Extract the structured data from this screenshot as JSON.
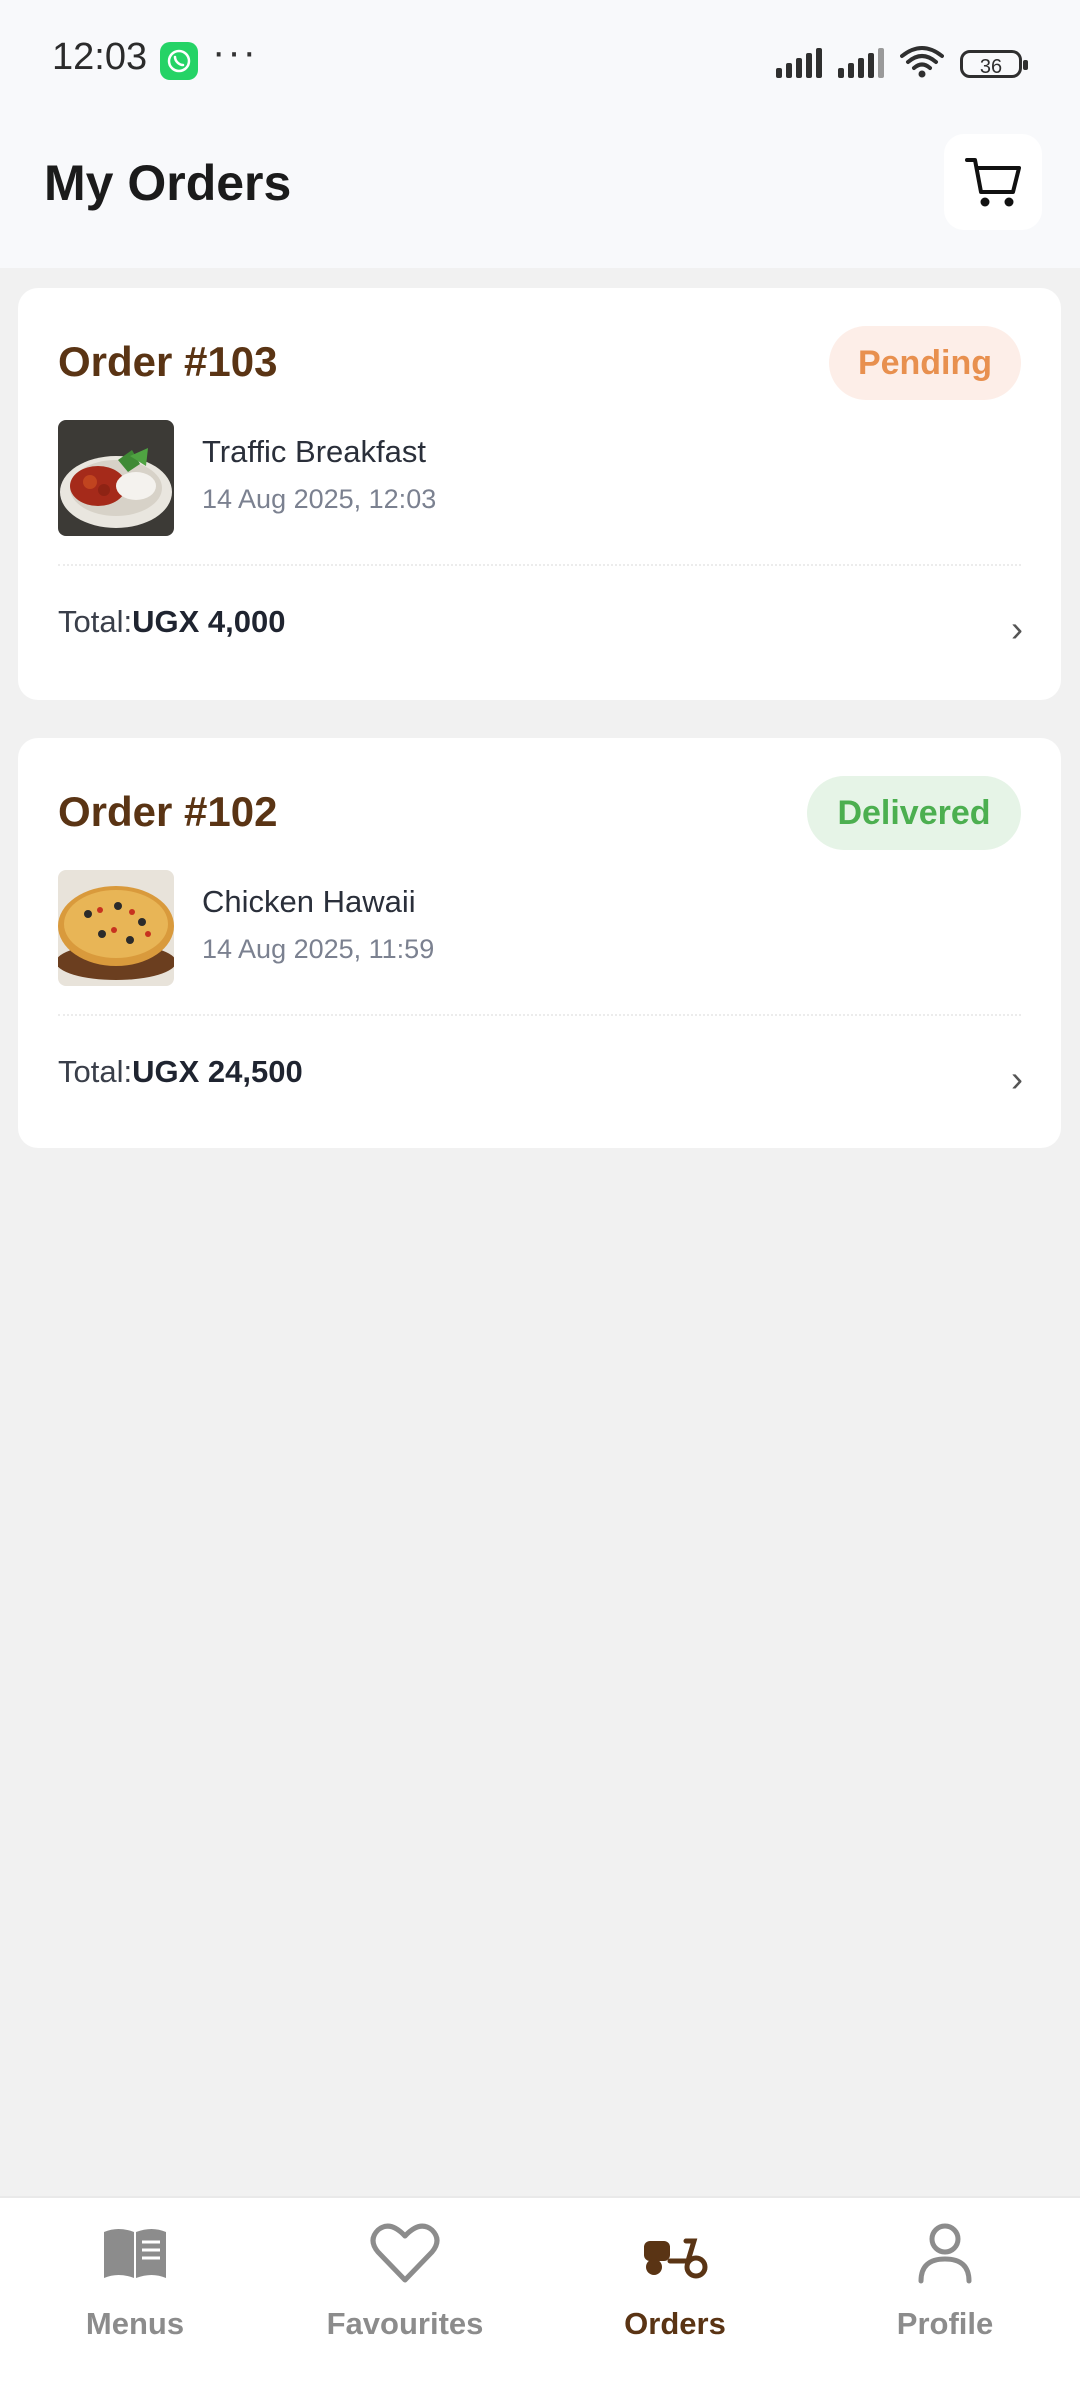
{
  "status_bar": {
    "time": "12:03",
    "battery": "36"
  },
  "header": {
    "title": "My Orders"
  },
  "orders": [
    {
      "title": "Order #103",
      "status": "Pending",
      "item_name": "Traffic Breakfast",
      "item_date": "14 Aug 2025, 12:03",
      "total_label": "Total:",
      "total_value": "UGX 4,000"
    },
    {
      "title": "Order #102",
      "status": "Delivered",
      "item_name": "Chicken Hawaii",
      "item_date": "14 Aug 2025, 11:59",
      "total_label": "Total:",
      "total_value": "UGX 24,500"
    }
  ],
  "nav": {
    "items": [
      {
        "label": "Menus",
        "icon": "book-icon"
      },
      {
        "label": "Favourites",
        "icon": "heart-icon"
      },
      {
        "label": "Orders",
        "icon": "scooter-icon",
        "active": true
      },
      {
        "label": "Profile",
        "icon": "user-icon"
      }
    ]
  },
  "colors": {
    "brand": "#5a3414",
    "pending_bg": "#fdeee8",
    "pending_text": "#e8904f",
    "delivered_bg": "#e6f4e7",
    "delivered_text": "#4caf50",
    "background": "#f1f1f1"
  }
}
